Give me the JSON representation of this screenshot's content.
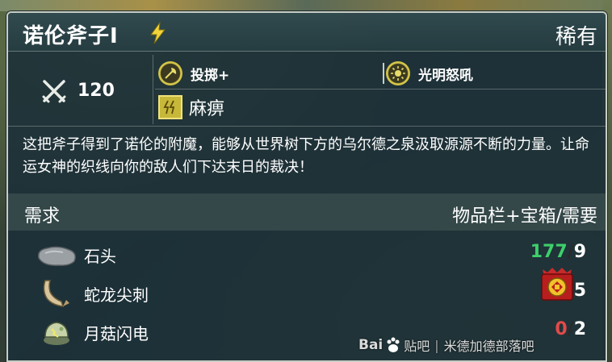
{
  "item": {
    "name": "诺伦斧子I",
    "rarity": "稀有"
  },
  "stats": {
    "damage": "120",
    "traits": [
      {
        "label": "投掷+",
        "icon": "axe-throw-icon"
      },
      {
        "label": "光明怒吼",
        "icon": "sun-roar-icon"
      }
    ],
    "effect": {
      "label": "麻痹",
      "icon": "paralysis-icon"
    }
  },
  "description": "这把斧子得到了诺伦的附魔，能够从世界树下方的乌尔德之泉汲取源源不断的力量。让命运女神的织线向你的敌人们下达末日的裁决！",
  "requirements": {
    "title": "需求",
    "columns": "物品栏+宝箱/需要",
    "items": [
      {
        "name": "石头",
        "have": "177",
        "sep": "/",
        "need": "9",
        "status": "ok",
        "icon": "stone-icon"
      },
      {
        "name": "蛇龙尖刺",
        "have": "",
        "sep": "",
        "need": "5",
        "status": "bad",
        "icon": "wyrm-spike-icon"
      },
      {
        "name": "月菇闪电",
        "have": "0",
        "sep": "/",
        "need": "2",
        "status": "bad",
        "icon": "moon-mushroom-icon"
      }
    ]
  },
  "watermark": {
    "logo": "Bai",
    "suffix": "贴吧",
    "forum": "米德加德部落吧"
  },
  "colors": {
    "panel": "#1c3038",
    "border": "#c8cec6",
    "have_ok": "#3ecf6c",
    "have_bad": "#e24a4a",
    "accent_gold": "#d8c84a"
  }
}
